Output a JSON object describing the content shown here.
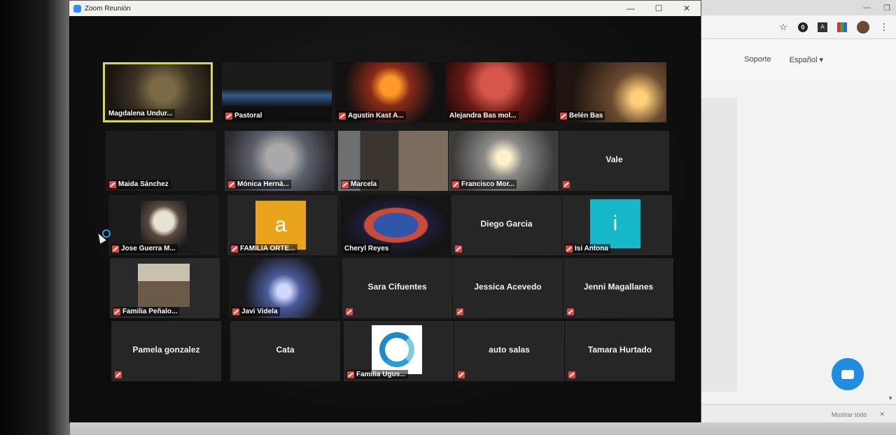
{
  "zoom": {
    "title": "Zoom Reunión",
    "controls": {
      "minimize": "—",
      "maximize": "☐",
      "close": "✕"
    },
    "participants": [
      {
        "name": "Magdalena Undur...",
        "video": "vid-photo1",
        "active": true,
        "muted": false
      },
      {
        "name": "Pastoral",
        "video": "vid-dark-blue",
        "muted": true
      },
      {
        "name": "Agustin Kast A...",
        "video": "vid-candle",
        "muted": true
      },
      {
        "name": "Alejandra Bas mol...",
        "video": "vid-red",
        "muted": false
      },
      {
        "name": "Belén Bas",
        "video": "vid-warm",
        "muted": true
      },
      {
        "name": "Maida Sánchez",
        "video": "vid-dark",
        "muted": true
      },
      {
        "name": "Mónica Herná...",
        "video": "vid-grey",
        "muted": true
      },
      {
        "name": "Marcela",
        "video": "vid-room",
        "muted": true
      },
      {
        "name": "Francisco Mor...",
        "video": "vid-candle2",
        "muted": true
      },
      {
        "center": "Vale",
        "muted": true
      },
      {
        "name": "Jose Guerra M...",
        "video": "vid-dark",
        "photo": true,
        "muted": true
      },
      {
        "name": "FAMILIA ORTE...",
        "avatar": "a",
        "avatar_color": "#eaa41c",
        "muted": true
      },
      {
        "name": "Cheryl Reyes",
        "video": "vid-cheryl",
        "muted": false
      },
      {
        "center": "Diego Garcia",
        "muted": true
      },
      {
        "name": "Isi Antona",
        "avatar": "i",
        "avatar_color": "#16b7c9",
        "muted": true
      },
      {
        "name": "Familia Peñalo...",
        "video": "vid-group",
        "groupphoto": true,
        "muted": true
      },
      {
        "name": "Javi Videla",
        "video": "vid-faces",
        "muted": true
      },
      {
        "center": "Sara Cifuentes",
        "muted": true
      },
      {
        "center": "Jessica Acevedo",
        "muted": true
      },
      {
        "center": "Jenni Magallanes",
        "muted": true
      },
      {
        "center": "Pamela gonzalez",
        "muted": true
      },
      {
        "center": "Cata",
        "muted": false
      },
      {
        "name": "Familia Ugus...",
        "logo": true,
        "muted": true
      },
      {
        "center": "auto salas",
        "muted": true
      },
      {
        "center": "Tamara Hurtado",
        "muted": true
      }
    ]
  },
  "browser": {
    "nav": {
      "support": "Soporte",
      "language": "Español ▾"
    },
    "downloads": {
      "show_all": "Mostrar todo",
      "close": "✕"
    },
    "tab_controls": {
      "minimize": "—",
      "restore": "❐"
    }
  }
}
